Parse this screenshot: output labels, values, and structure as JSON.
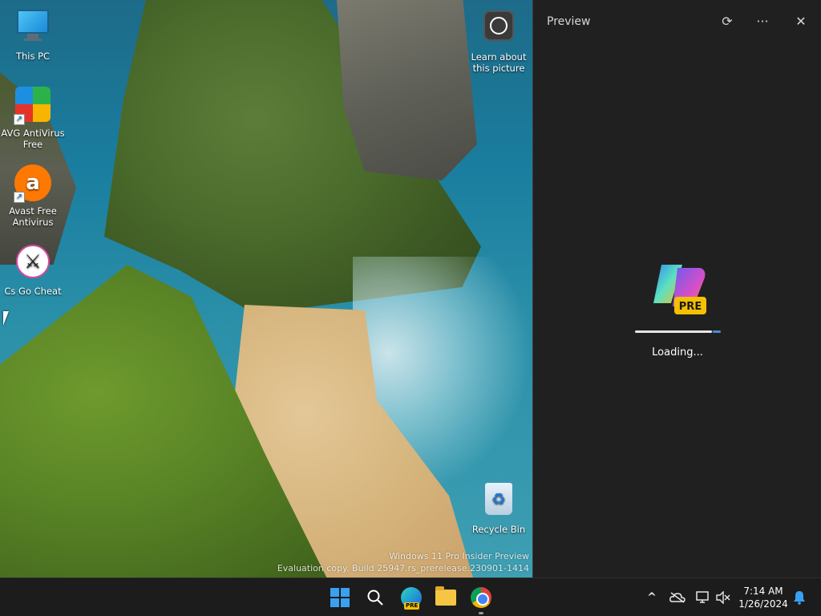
{
  "desktop": {
    "icons": [
      {
        "label": "This PC",
        "icon": "this-pc-icon"
      },
      {
        "label": "AVG AntiVirus Free",
        "icon": "avg-icon"
      },
      {
        "label": "Avast Free Antivirus",
        "icon": "avast-icon"
      },
      {
        "label": "Cs Go Cheat",
        "icon": "csgo-icon"
      },
      {
        "label": "Learn about this picture",
        "icon": "learn-picture-icon"
      },
      {
        "label": "Recycle Bin",
        "icon": "recycle-bin-icon"
      }
    ],
    "watermark": {
      "line1": "Windows 11 Pro Insider Preview",
      "line2": "Evaluation copy. Build 25947.rs_prerelease.230901-1414"
    }
  },
  "preview": {
    "title": "Preview",
    "refresh_glyph": "⟳",
    "more_glyph": "···",
    "close_glyph": "✕",
    "logo_badge": "PRE",
    "loading_text": "Loading...",
    "progress": 0.9
  },
  "taskbar": {
    "pinned": [
      "start-icon",
      "search-icon",
      "edge-preview-icon",
      "file-explorer-icon",
      "chrome-icon"
    ],
    "edge_badge": "PRE",
    "tray": {
      "chevron_glyph": "^",
      "time": "7:14 AM",
      "date": "1/26/2024"
    }
  },
  "colors": {
    "accent": "#3aa0f0",
    "panel_bg": "#202020",
    "taskbar_bg": "#1c1c1c"
  }
}
